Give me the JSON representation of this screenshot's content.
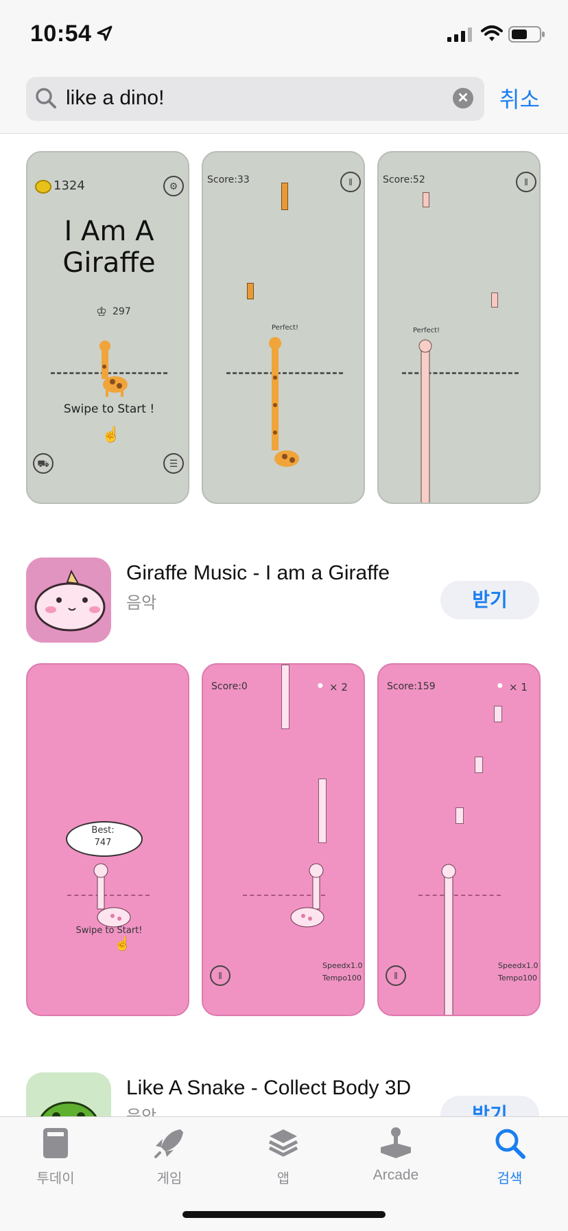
{
  "status_bar": {
    "time": "10:54"
  },
  "search": {
    "query": "like a dino!",
    "cancel_label": "취소"
  },
  "app1_screens": {
    "s1": {
      "coins": "1324",
      "title_line1": "I Am A",
      "title_line2": "Giraffe",
      "best": "297",
      "swipe": "Swipe to Start !"
    },
    "s2": {
      "score": "Score:33",
      "perfect": "Perfect!"
    },
    "s3": {
      "score": "Score:52",
      "perfect": "Perfect!"
    }
  },
  "app2": {
    "name": "Giraffe Music - I am a Giraffe",
    "category": "음악",
    "get_label": "받기",
    "screens": {
      "s1": {
        "best_label": "Best:",
        "best_value": "747",
        "swipe": "Swipe to Start!"
      },
      "s2": {
        "score": "Score:0",
        "lives": "× 2",
        "speed": "Speedx1.0",
        "tempo": "Tempo100"
      },
      "s3": {
        "score": "Score:159",
        "lives": "× 1",
        "speed": "Speedx1.0",
        "tempo": "Tempo100"
      }
    }
  },
  "app3": {
    "name": "Like A Snake - Collect Body 3D",
    "category": "음악",
    "get_label": "받기"
  },
  "tabbar": {
    "tabs": [
      {
        "label": "투데이",
        "icon": "today-icon"
      },
      {
        "label": "게임",
        "icon": "rocket-icon"
      },
      {
        "label": "앱",
        "icon": "layers-icon"
      },
      {
        "label": "Arcade",
        "icon": "arcade-joystick-icon"
      },
      {
        "label": "검색",
        "icon": "search-icon"
      }
    ],
    "active_color": "#1a7ef0"
  }
}
